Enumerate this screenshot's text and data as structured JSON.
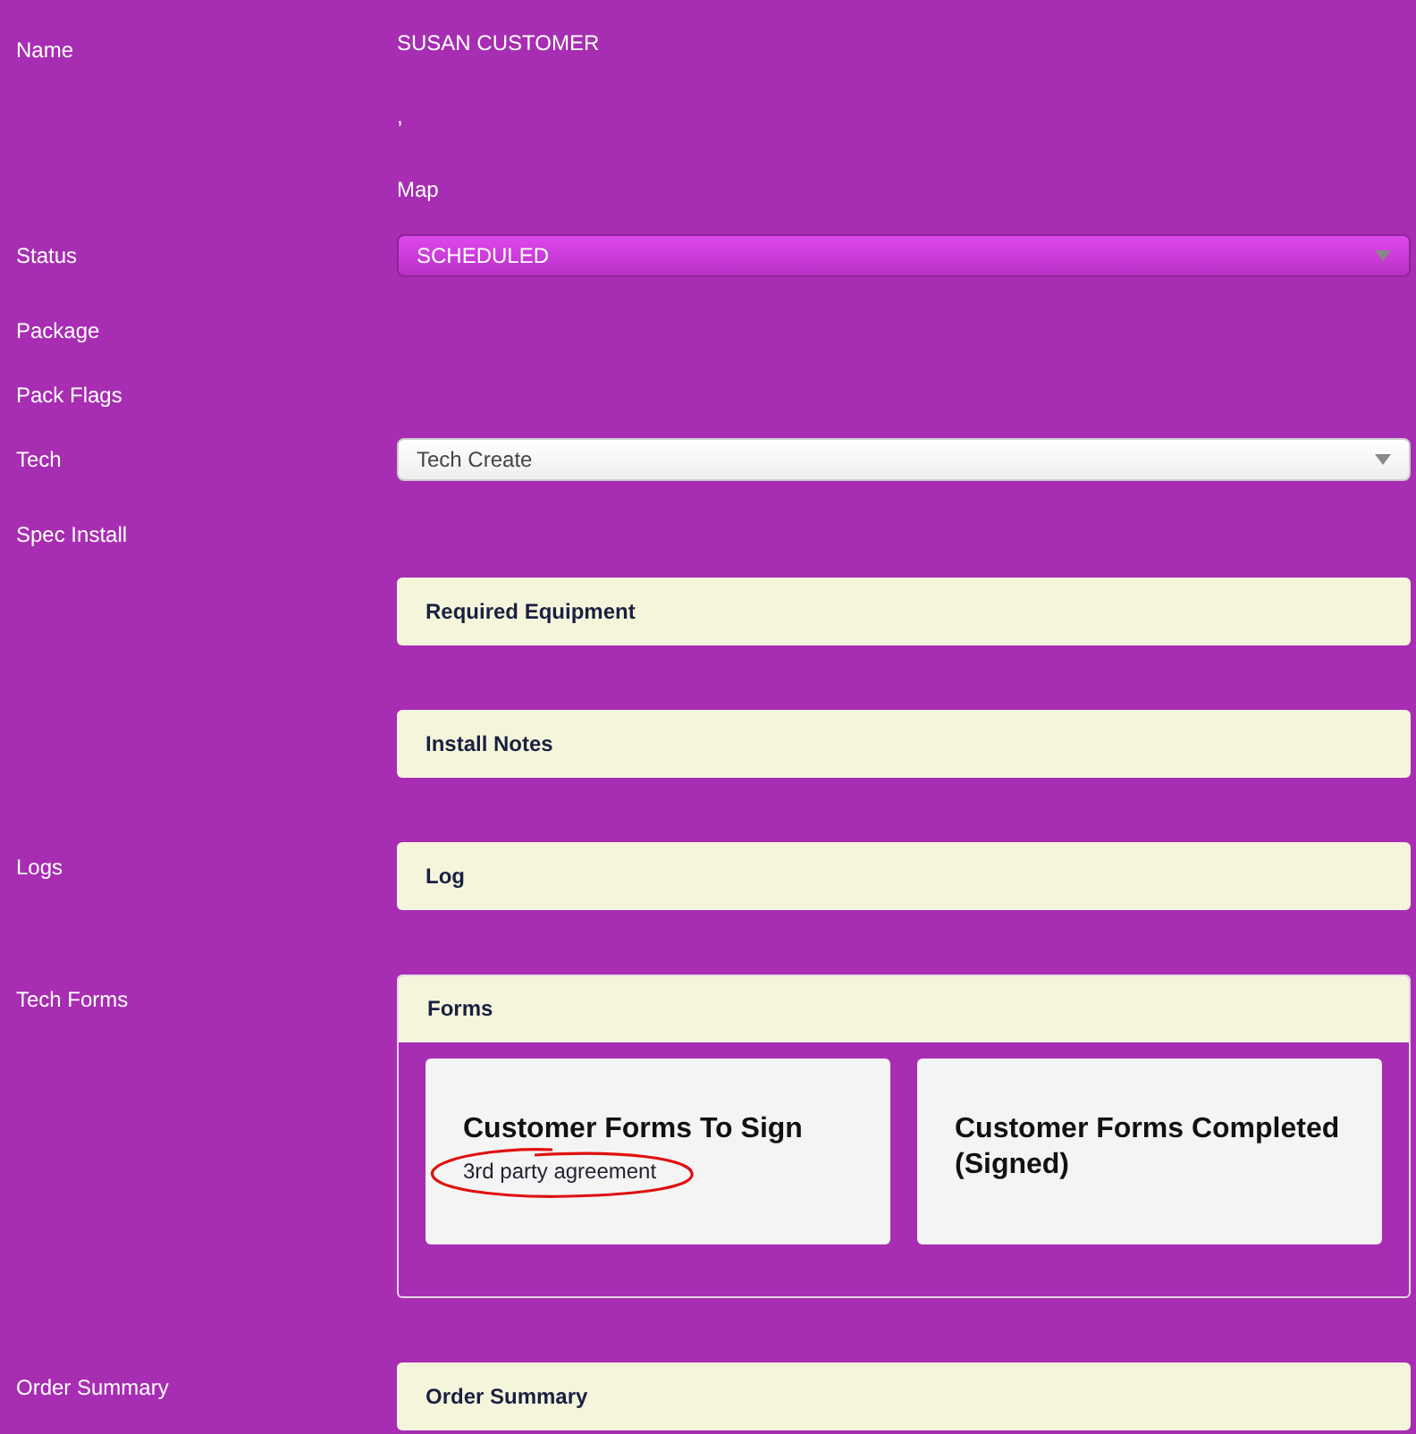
{
  "rows": [
    {
      "label": "Name",
      "kind": "text",
      "lines": [
        "SUSAN CUSTOMER",
        ",",
        "Map"
      ]
    },
    {
      "label": "Status",
      "kind": "select",
      "value": "SCHEDULED",
      "highlighted": true
    },
    {
      "label": "Package",
      "kind": "empty"
    },
    {
      "label": "Pack Flags",
      "kind": "empty"
    },
    {
      "label": "Tech",
      "kind": "select",
      "value": "Tech Create",
      "highlighted": false
    },
    {
      "label": "Spec Install",
      "kind": "empty"
    },
    {
      "kind": "panel",
      "title": "Required Equipment"
    },
    {
      "kind": "panel",
      "title": "Install Notes"
    },
    {
      "label": "Logs",
      "kind": "panel",
      "title": "Log"
    },
    {
      "label": "Tech Forms",
      "kind": "forms",
      "title": "Forms",
      "cards": [
        {
          "title": "Customer Forms To Sign",
          "items": [
            "3rd party agreement"
          ]
        },
        {
          "title": "Customer Forms Completed (Signed)"
        }
      ]
    },
    {
      "label": "Order Summary",
      "kind": "panel",
      "title": "Order Summary"
    }
  ]
}
